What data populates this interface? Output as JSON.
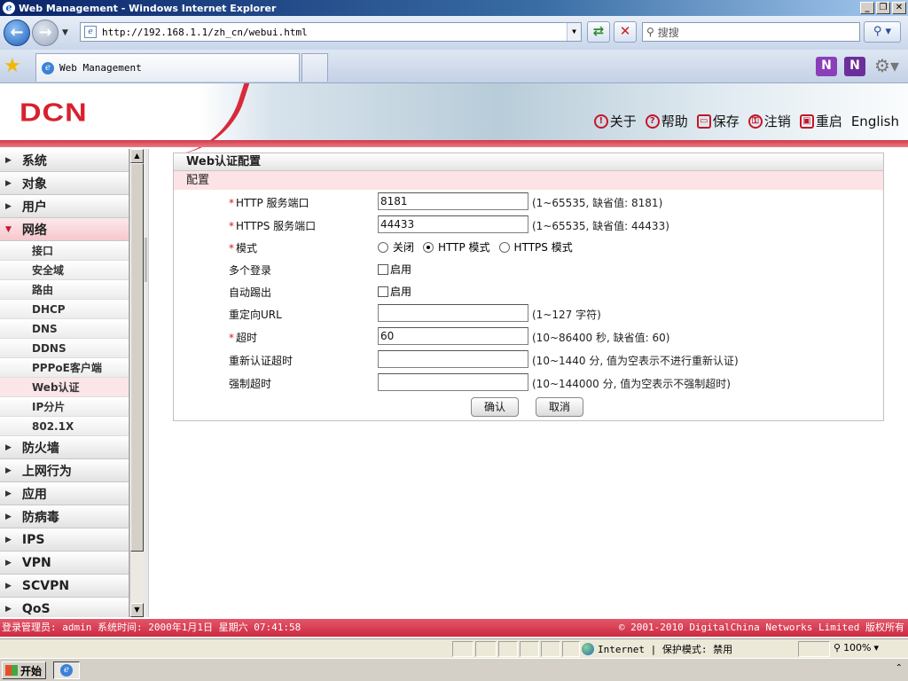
{
  "window": {
    "title": "Web Management - Windows Internet Explorer",
    "controls": [
      "_",
      "❐",
      "✕"
    ]
  },
  "browser": {
    "address": "http://192.168.1.1/zh_cn/webui.html",
    "search_placeholder": "搜搜",
    "tab_title": "Web Management"
  },
  "header": {
    "logo": "DCN",
    "menu": [
      {
        "label": "关于",
        "icon": "!"
      },
      {
        "label": "帮助",
        "icon": "?"
      },
      {
        "label": "保存",
        "icon": "▭"
      },
      {
        "label": "注销",
        "icon": "⚿"
      },
      {
        "label": "重启",
        "icon": "▣"
      },
      {
        "label": "English",
        "icon": ""
      }
    ]
  },
  "sidebar": {
    "items": [
      {
        "label": "系统",
        "open": false
      },
      {
        "label": "对象",
        "open": false
      },
      {
        "label": "用户",
        "open": false
      },
      {
        "label": "网络",
        "open": true
      },
      {
        "label": "防火墙",
        "open": false
      },
      {
        "label": "上网行为",
        "open": false
      },
      {
        "label": "应用",
        "open": false
      },
      {
        "label": "防病毒",
        "open": false
      },
      {
        "label": "IPS",
        "open": false
      },
      {
        "label": "VPN",
        "open": false
      },
      {
        "label": "SCVPN",
        "open": false
      },
      {
        "label": "QoS",
        "open": false
      }
    ],
    "subitems": [
      "接口",
      "安全域",
      "路由",
      "DHCP",
      "DNS",
      "DDNS",
      "PPPoE客户端",
      "Web认证",
      "IP分片",
      "802.1X"
    ],
    "active_sub": "Web认证"
  },
  "panel": {
    "title": "Web认证配置",
    "section": "配置",
    "fields": {
      "http_port": {
        "label": "HTTP 服务端口",
        "value": "8181",
        "hint": "(1~65535, 缺省值: 8181)"
      },
      "https_port": {
        "label": "HTTPS 服务端口",
        "value": "44433",
        "hint": "(1~65535, 缺省值: 44433)"
      },
      "mode": {
        "label": "模式",
        "options": [
          "关闭",
          "HTTP 模式",
          "HTTPS 模式"
        ],
        "selected": "HTTP 模式"
      },
      "multi_login": {
        "label": "多个登录",
        "check_label": "启用"
      },
      "auto_kick": {
        "label": "自动踢出",
        "check_label": "启用"
      },
      "redirect_url": {
        "label": "重定向URL",
        "value": "",
        "hint": "(1~127 字符)"
      },
      "timeout": {
        "label": "超时",
        "value": "60",
        "hint": "(10~86400 秒, 缺省值: 60)"
      },
      "reauth_timeout": {
        "label": "重新认证超时",
        "value": "",
        "hint": "(10~1440 分, 值为空表示不进行重新认证)"
      },
      "force_timeout": {
        "label": "强制超时",
        "value": "",
        "hint": "(10~144000 分, 值为空表示不强制超时)"
      }
    },
    "ok_label": "确认",
    "cancel_label": "取消"
  },
  "footer": {
    "left": "登录管理员: admin 系统时间: 2000年1月1日 星期六 07:41:58",
    "right": "© 2001-2010 DigitalChina Networks Limited 版权所有"
  },
  "statusbar": {
    "zone": "Internet | 保护模式: 禁用",
    "zoom": "100%"
  },
  "taskbar": {
    "start_label": "开始"
  },
  "colors": {
    "brand_red": "#d8202e",
    "accent_pink": "#fde3e5",
    "titlebar_blue": "#0a246a"
  }
}
